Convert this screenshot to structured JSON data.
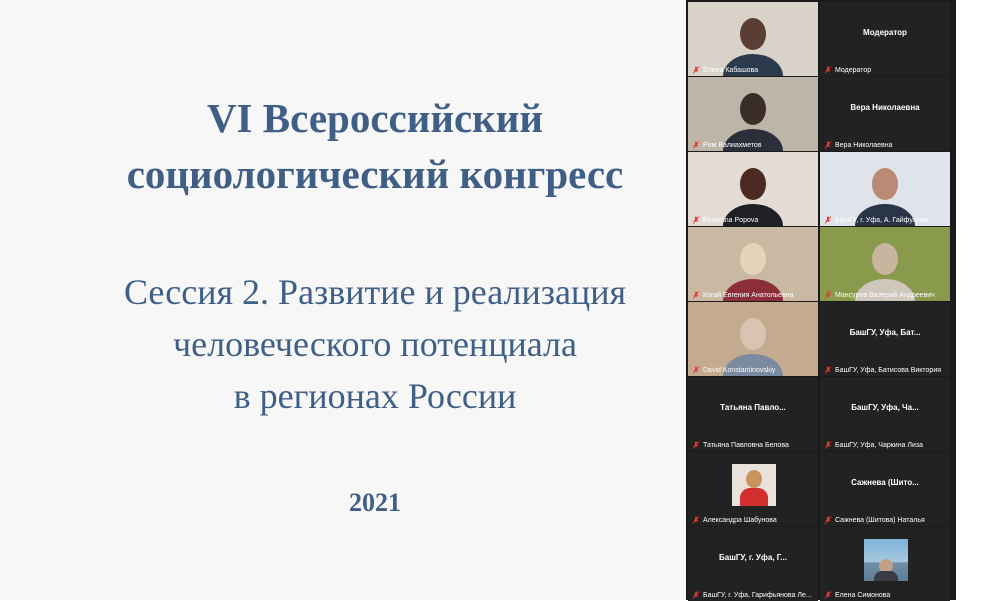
{
  "slide": {
    "title_line1": "VI Всероссийский",
    "title_line2": "социологический конгресс",
    "subtitle_line1": "Сессия 2. Развитие и реализация",
    "subtitle_line2": "человеческого потенциала",
    "subtitle_line3": "в регионах России",
    "year": "2021"
  },
  "participants": [
    {
      "name": "Елена Кабашова",
      "center": ""
    },
    {
      "name": "Модератор",
      "center": "Модератор"
    },
    {
      "name": "Рим Валиахметов",
      "center": ""
    },
    {
      "name": "Вера Николаевна",
      "center": "Вера Николаевна"
    },
    {
      "name": "Ekaterina Popova",
      "center": ""
    },
    {
      "name": "БашГУ, г. Уфа, А. Гайфуллин",
      "center": ""
    },
    {
      "name": "Когай Евгения Анатольевна",
      "center": ""
    },
    {
      "name": "Мансуров Валерий Андреевич",
      "center": ""
    },
    {
      "name": "David Konstantinovskiy",
      "center": ""
    },
    {
      "name": "БашГУ, Уфа, Батисова Виктория",
      "center": "БашГУ, Уфа, Бат..."
    },
    {
      "name": "Татьяна Павловна Белова",
      "center": "Татьяна  Павло..."
    },
    {
      "name": "БашГУ, Уфа, Чаркина Лиза",
      "center": "БашГУ, Уфа, Ча..."
    },
    {
      "name": "Александра Шабунова",
      "center": ""
    },
    {
      "name": "Сажнева (Шитова) Наталья",
      "center": "Сажнева  (Шито..."
    },
    {
      "name": "БашГУ, г. Уфа, Гарифьянова Ле...",
      "center": "БашГУ, г. Уфа, Г..."
    },
    {
      "name": "Елена Симонова",
      "center": ""
    }
  ],
  "colors": {
    "slide_text": "#3f5f86",
    "gallery_bg": "#1a1a1a",
    "tile_bg": "#222222",
    "active_outline": "#a6d21f",
    "mic_muted": "#e53935"
  }
}
